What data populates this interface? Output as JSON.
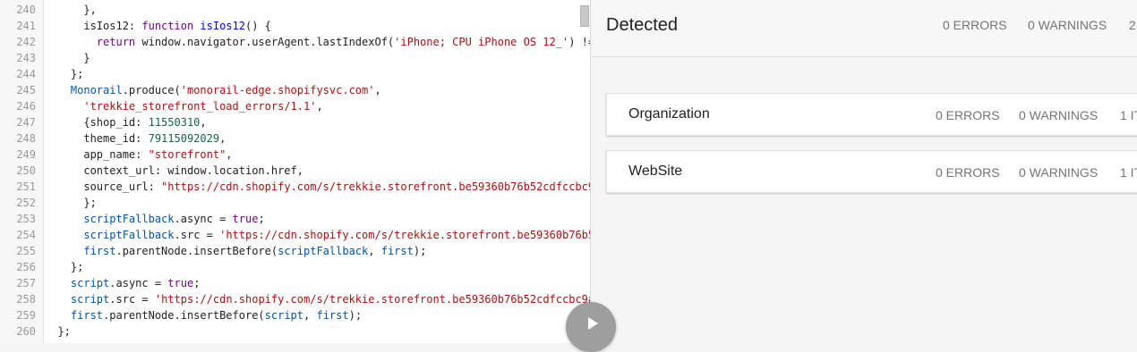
{
  "editor": {
    "lines": [
      {
        "n": "240",
        "tokens": [
          {
            "t": "      },",
            "c": ""
          }
        ]
      },
      {
        "n": "241",
        "tokens": [
          {
            "t": "      isIos12: ",
            "c": ""
          },
          {
            "t": "function",
            "c": "kw"
          },
          {
            "t": " ",
            "c": ""
          },
          {
            "t": "isIos12",
            "c": "def"
          },
          {
            "t": "() {",
            "c": ""
          }
        ]
      },
      {
        "n": "242",
        "tokens": [
          {
            "t": "        ",
            "c": ""
          },
          {
            "t": "return",
            "c": "kw"
          },
          {
            "t": " window.navigator.userAgent.lastIndexOf(",
            "c": ""
          },
          {
            "t": "'iPhone; CPU iPhone OS 12_'",
            "c": "str"
          },
          {
            "t": ") !=",
            "c": ""
          }
        ]
      },
      {
        "n": "243",
        "tokens": [
          {
            "t": "      }",
            "c": ""
          }
        ]
      },
      {
        "n": "244",
        "tokens": [
          {
            "t": "    };",
            "c": ""
          }
        ]
      },
      {
        "n": "245",
        "tokens": [
          {
            "t": "    ",
            "c": ""
          },
          {
            "t": "Monorail",
            "c": "var"
          },
          {
            "t": ".produce(",
            "c": ""
          },
          {
            "t": "'monorail-edge.shopifysvc.com'",
            "c": "str"
          },
          {
            "t": ",",
            "c": ""
          }
        ]
      },
      {
        "n": "246",
        "tokens": [
          {
            "t": "      ",
            "c": ""
          },
          {
            "t": "'trekkie_storefront_load_errors/1.1'",
            "c": "str"
          },
          {
            "t": ",",
            "c": ""
          }
        ]
      },
      {
        "n": "247",
        "tokens": [
          {
            "t": "      {shop_id: ",
            "c": ""
          },
          {
            "t": "11550310",
            "c": "num"
          },
          {
            "t": ",",
            "c": ""
          }
        ]
      },
      {
        "n": "248",
        "tokens": [
          {
            "t": "      theme_id: ",
            "c": ""
          },
          {
            "t": "79115092029",
            "c": "num"
          },
          {
            "t": ",",
            "c": ""
          }
        ]
      },
      {
        "n": "249",
        "tokens": [
          {
            "t": "      app_name: ",
            "c": ""
          },
          {
            "t": "\"storefront\"",
            "c": "str"
          },
          {
            "t": ",",
            "c": ""
          }
        ]
      },
      {
        "n": "250",
        "tokens": [
          {
            "t": "      context_url: window.location.href,",
            "c": ""
          }
        ]
      },
      {
        "n": "251",
        "tokens": [
          {
            "t": "      source_url: ",
            "c": ""
          },
          {
            "t": "\"https://cdn.shopify.com/s/trekkie.storefront.be59360b76b52cdfccbc9",
            "c": "str"
          }
        ]
      },
      {
        "n": "252",
        "tokens": [
          {
            "t": "      };",
            "c": ""
          }
        ]
      },
      {
        "n": "253",
        "tokens": [
          {
            "t": "      ",
            "c": ""
          },
          {
            "t": "scriptFallback",
            "c": "var"
          },
          {
            "t": ".async = ",
            "c": ""
          },
          {
            "t": "true",
            "c": "kw"
          },
          {
            "t": ";",
            "c": ""
          }
        ]
      },
      {
        "n": "254",
        "tokens": [
          {
            "t": "      ",
            "c": ""
          },
          {
            "t": "scriptFallback",
            "c": "var"
          },
          {
            "t": ".src = ",
            "c": ""
          },
          {
            "t": "'https://cdn.shopify.com/s/trekkie.storefront.be59360b76b5",
            "c": "str"
          }
        ]
      },
      {
        "n": "255",
        "tokens": [
          {
            "t": "      ",
            "c": ""
          },
          {
            "t": "first",
            "c": "var"
          },
          {
            "t": ".parentNode.insertBefore(",
            "c": ""
          },
          {
            "t": "scriptFallback",
            "c": "var"
          },
          {
            "t": ", ",
            "c": ""
          },
          {
            "t": "first",
            "c": "var"
          },
          {
            "t": ");",
            "c": ""
          }
        ]
      },
      {
        "n": "256",
        "tokens": [
          {
            "t": "    };",
            "c": ""
          }
        ]
      },
      {
        "n": "257",
        "tokens": [
          {
            "t": "    ",
            "c": ""
          },
          {
            "t": "script",
            "c": "var"
          },
          {
            "t": ".async = ",
            "c": ""
          },
          {
            "t": "true",
            "c": "kw"
          },
          {
            "t": ";",
            "c": ""
          }
        ]
      },
      {
        "n": "258",
        "tokens": [
          {
            "t": "    ",
            "c": ""
          },
          {
            "t": "script",
            "c": "var"
          },
          {
            "t": ".src = ",
            "c": ""
          },
          {
            "t": "'https://cdn.shopify.com/s/trekkie.storefront.be59360b76b52cdfccbc9a",
            "c": "str"
          }
        ]
      },
      {
        "n": "259",
        "tokens": [
          {
            "t": "    ",
            "c": ""
          },
          {
            "t": "first",
            "c": "var"
          },
          {
            "t": ".parentNode.insertBefore(",
            "c": ""
          },
          {
            "t": "script",
            "c": "var"
          },
          {
            "t": ", ",
            "c": ""
          },
          {
            "t": "first",
            "c": "var"
          },
          {
            "t": ");",
            "c": ""
          }
        ]
      },
      {
        "n": "260",
        "tokens": [
          {
            "t": "  };",
            "c": ""
          }
        ]
      }
    ]
  },
  "results": {
    "title": "Detected",
    "errors": "0 ERRORS",
    "warnings": "0 WARNINGS",
    "items": "2",
    "cards": [
      {
        "name": "Organization",
        "errors": "0 ERRORS",
        "warnings": "0 WARNINGS",
        "items": "1 IT"
      },
      {
        "name": "WebSite",
        "errors": "0 ERRORS",
        "warnings": "0 WARNINGS",
        "items": "1 IT"
      }
    ]
  }
}
